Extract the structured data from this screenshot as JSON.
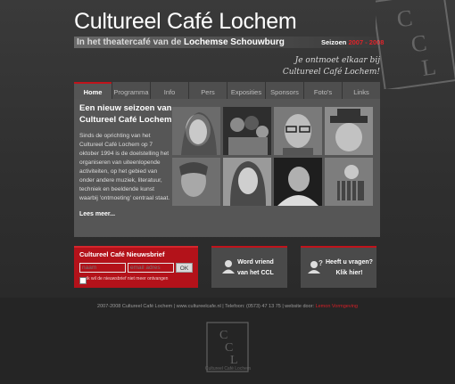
{
  "header": {
    "title": "Cultureel Café Lochem",
    "subtitle_prefix": "In het theatercafé van de",
    "subtitle_strong": "Lochemse Schouwburg",
    "season_label": "Seizoen",
    "season_start": "2007",
    "season_sep": " - ",
    "season_end": "2008",
    "slogan_line1": "Je ontmoet elkaar bij",
    "slogan_line2": "Cultureel Café Lochem!",
    "logo_letters": "CCL"
  },
  "nav": {
    "items": [
      {
        "label": "Home",
        "active": true
      },
      {
        "label": "Programma"
      },
      {
        "label": "Info"
      },
      {
        "label": "Pers"
      },
      {
        "label": "Exposities"
      },
      {
        "label": "Sponsors"
      },
      {
        "label": "Foto's"
      },
      {
        "label": "Links"
      }
    ]
  },
  "intro": {
    "title": "Een nieuw seizoen van Cultureel Café Lochem",
    "body": "Sinds de oprichting van het Cultureel Café Lochem op 7 oktober 1994 is de doelstelling het organiseren van uiteenlopende activiteiten, op het gebied van onder andere muziek, literatuur, techniek en beeldende kunst waarbij 'ontmoeting' centraal staat.",
    "read_more": "Lees meer..."
  },
  "newsletter": {
    "title": "Cultureel Café Nieuwsbrief",
    "name_placeholder": "naam",
    "email_placeholder": "email adres",
    "ok_label": "OK",
    "unsubscribe_label": "ik wil de nieuwsbrief niet meer ontvangen"
  },
  "boxes": {
    "friend_line1": "Word vriend",
    "friend_line2": "van het CCL",
    "question_line1": "Heeft u vragen?",
    "question_line2": "Klik hier!"
  },
  "footer": {
    "text": "2007-2008 Cultureel Café Lochem | www.cultureelcafe.nl | Telefoon: (0573) 47 13 75 | website door:",
    "credit": "Lemon Vormgeving",
    "logo_caption": "Cultureel Café Lochem"
  },
  "colors": {
    "accent_red": "#c0141c",
    "newsletter_red": "#b3121a"
  }
}
